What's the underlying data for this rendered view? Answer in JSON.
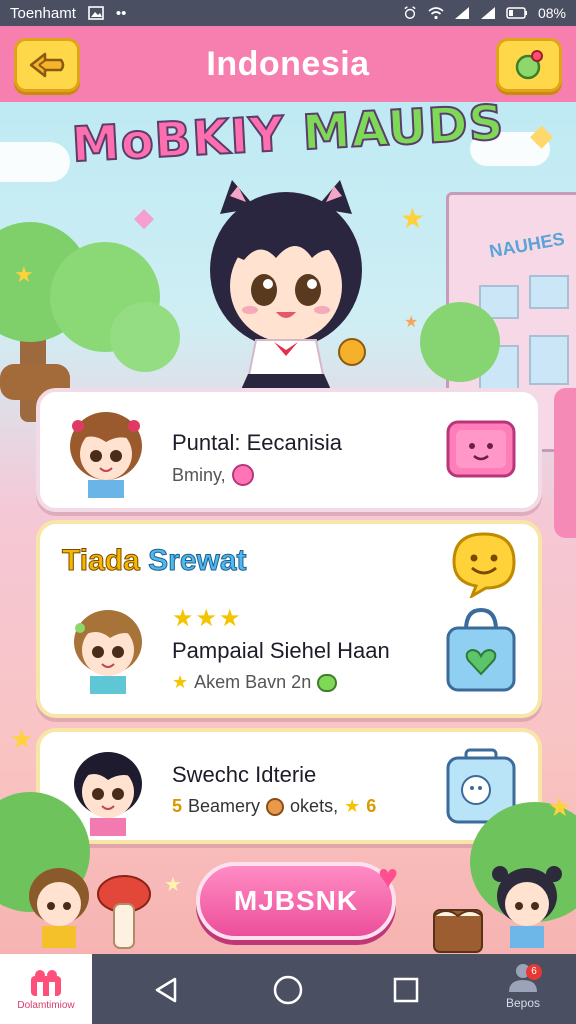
{
  "status_bar": {
    "carrier": "Toenhamt",
    "dots": "••",
    "battery": "08%"
  },
  "header": {
    "title": "Indonesia"
  },
  "logo": {
    "part1": "MoBKIY",
    "part2": "MAUDS"
  },
  "building_sign": "NAUHES",
  "cards": [
    {
      "title": "Puntal: Eecanisia",
      "sub": "Bminy,"
    },
    {
      "section_word1": "Tiada",
      "section_word2": "Srewat",
      "stars": "★★★",
      "title": "Pampaial Siehel Haan",
      "sub": "Akem Bavn 2n"
    },
    {
      "title": "Swechc Idterie",
      "sub_prefix": "5",
      "sub": "Beamery",
      "sub_mid": "okets,",
      "sub_suffix": "6"
    }
  ],
  "play_button": {
    "label": "MJBSNK"
  },
  "nav": {
    "home_label": "Dolamtimiow",
    "profile_label": "Bepos",
    "profile_badge": "6"
  },
  "colors": {
    "header_pink": "#f77fb0",
    "accent_yellow": "#ffd84a",
    "button_pink": "#ec4f9a",
    "navbar": "#4a5062"
  }
}
